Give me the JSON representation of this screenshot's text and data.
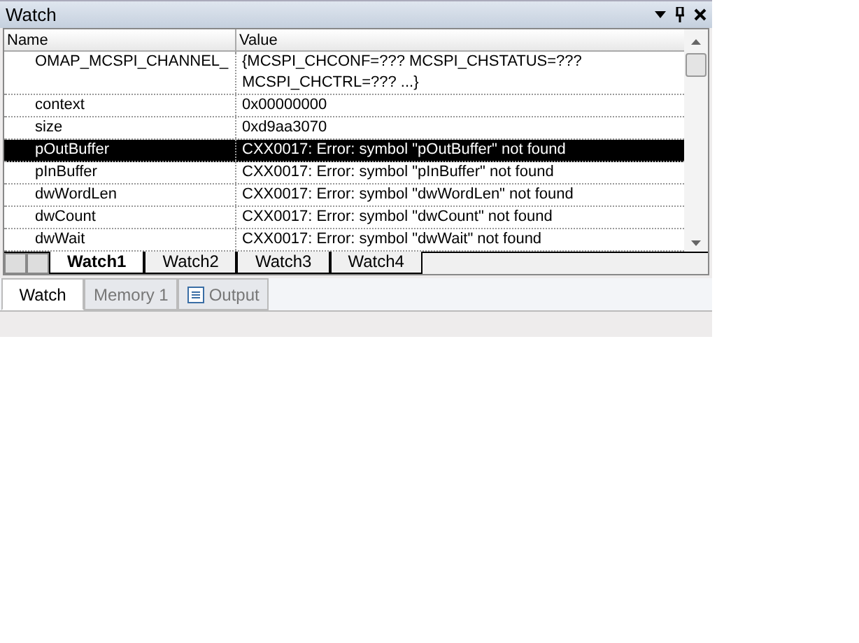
{
  "window": {
    "title": "Watch"
  },
  "table": {
    "columns": [
      "Name",
      "Value"
    ],
    "rows": [
      {
        "name": "OMAP_MCSPI_CHANNEL_",
        "value": "{MCSPI_CHCONF=??? MCSPI_CHSTATUS=??? MCSPI_CHCTRL=??? ...}",
        "selected": false
      },
      {
        "name": "context",
        "value": "0x00000000",
        "selected": false
      },
      {
        "name": "size",
        "value": "0xd9aa3070",
        "selected": false
      },
      {
        "name": "pOutBuffer",
        "value": "CXX0017: Error: symbol \"pOutBuffer\" not found",
        "selected": true
      },
      {
        "name": "pInBuffer",
        "value": "CXX0017: Error: symbol \"pInBuffer\" not found",
        "selected": false
      },
      {
        "name": "dwWordLen",
        "value": "CXX0017: Error: symbol \"dwWordLen\" not found",
        "selected": false
      },
      {
        "name": "dwCount",
        "value": "CXX0017: Error: symbol \"dwCount\" not found",
        "selected": false
      },
      {
        "name": "dwWait",
        "value": "CXX0017: Error: symbol \"dwWait\" not found",
        "selected": false
      }
    ]
  },
  "sheet_tabs": [
    {
      "label": "Watch1",
      "selected": true
    },
    {
      "label": "Watch2",
      "selected": false
    },
    {
      "label": "Watch3",
      "selected": false
    },
    {
      "label": "Watch4",
      "selected": false
    }
  ],
  "panel_tabs": [
    {
      "label": "Watch",
      "selected": true,
      "kind": "plain"
    },
    {
      "label": "Memory 1",
      "selected": false,
      "kind": "plain"
    },
    {
      "label": "Output",
      "selected": false,
      "kind": "icon"
    }
  ]
}
